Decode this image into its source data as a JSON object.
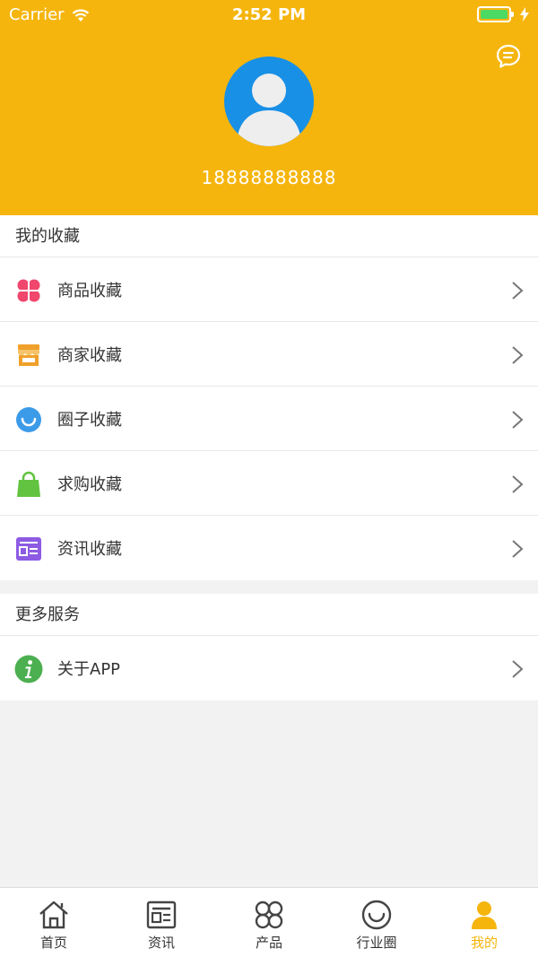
{
  "status_bar": {
    "carrier": "Carrier",
    "time": "2:52 PM"
  },
  "profile": {
    "phone": "18888888888"
  },
  "favorites": {
    "title": "我的收藏",
    "items": [
      {
        "label": "商品收藏",
        "icon": "flower-icon",
        "color": "#f0476d"
      },
      {
        "label": "商家收藏",
        "icon": "store-icon",
        "color": "#f0a12b"
      },
      {
        "label": "圈子收藏",
        "icon": "circle-smile-icon",
        "color": "#3c9be8"
      },
      {
        "label": "求购收藏",
        "icon": "shopping-bag-icon",
        "color": "#62c341"
      },
      {
        "label": "资讯收藏",
        "icon": "news-icon",
        "color": "#8d5be3"
      }
    ]
  },
  "services": {
    "title": "更多服务",
    "items": [
      {
        "label": "关于APP",
        "icon": "info-icon",
        "color": "#4caf50"
      }
    ]
  },
  "tabbar": {
    "items": [
      {
        "label": "首页",
        "icon": "home-icon"
      },
      {
        "label": "资讯",
        "icon": "news-icon"
      },
      {
        "label": "产品",
        "icon": "grid-icon"
      },
      {
        "label": "行业圈",
        "icon": "circle-smile-icon"
      },
      {
        "label": "我的",
        "icon": "user-icon"
      }
    ],
    "active_color": "#f5b50d"
  },
  "colors": {
    "header_bg": "#f5b50d",
    "avatar_bg": "#1890e6",
    "page_bg": "#f2f2f2"
  }
}
